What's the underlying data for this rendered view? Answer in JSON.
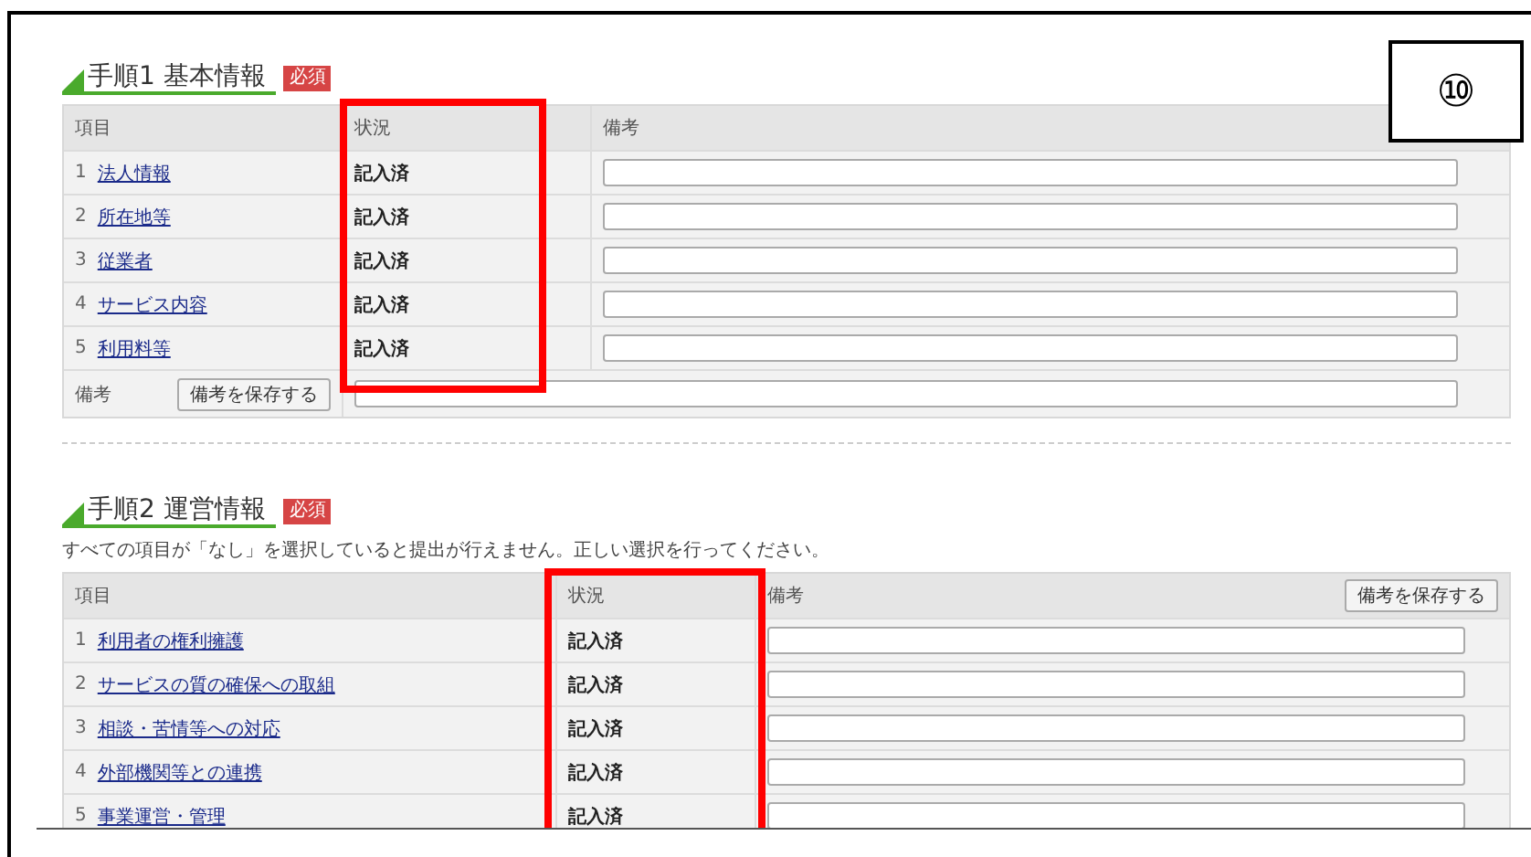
{
  "annotation_label": "⑩",
  "sections": [
    {
      "title": "手順1 基本情報",
      "badge": "必須",
      "highlight": true,
      "columns": [
        "項目",
        "状況",
        "備考"
      ],
      "rows": [
        {
          "number": "1",
          "label": "法人情報",
          "status": "記入済"
        },
        {
          "number": "2",
          "label": "所在地等",
          "status": "記入済"
        },
        {
          "number": "3",
          "label": "従業者",
          "status": "記入済"
        },
        {
          "number": "4",
          "label": "サービス内容",
          "status": "記入済"
        },
        {
          "number": "5",
          "label": "利用料等",
          "status": "記入済"
        }
      ],
      "remarks_row": {
        "label": "備考",
        "button": "備考を保存する"
      }
    },
    {
      "title": "手順2 運営情報",
      "badge": "必須",
      "highlight": true,
      "notice": "すべての項目が「なし」を選択していると提出が行えません。正しい選択を行ってください。",
      "columns": [
        "項目",
        "状況",
        "備考"
      ],
      "header_button": "備考を保存する",
      "rows": [
        {
          "number": "1",
          "label": "利用者の権利擁護",
          "status": "記入済"
        },
        {
          "number": "2",
          "label": "サービスの質の確保への取組",
          "status": "記入済"
        },
        {
          "number": "3",
          "label": "相談・苦情等への対応",
          "status": "記入済"
        },
        {
          "number": "4",
          "label": "外部機関等との連携",
          "status": "記入済"
        },
        {
          "number": "5",
          "label": "事業運営・管理",
          "status": "記入済"
        }
      ]
    }
  ]
}
